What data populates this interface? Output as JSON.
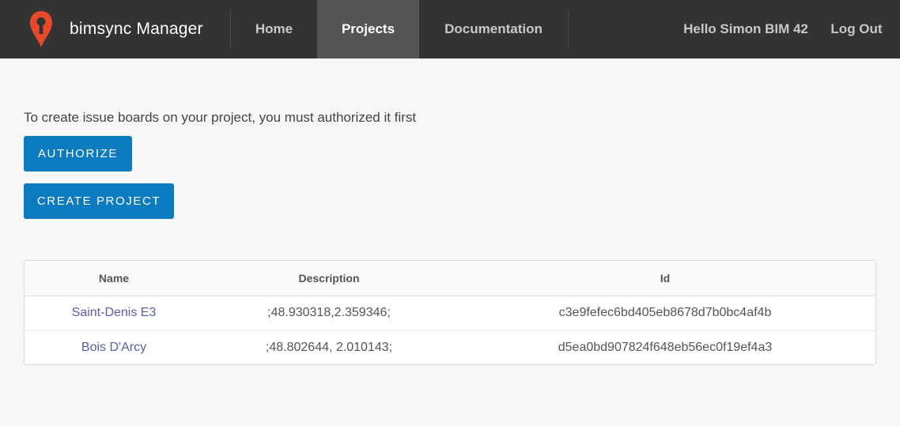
{
  "header": {
    "brand_name": "bimsync Manager",
    "logo_icon": "map-pin-icon",
    "nav": {
      "home": "Home",
      "projects": "Projects",
      "documentation": "Documentation"
    },
    "greeting": "Hello Simon BIM 42",
    "logout": "Log Out",
    "colors": {
      "bar": "#333333",
      "active_tab": "#555555",
      "logo": "#e8492a"
    }
  },
  "main": {
    "intro_text": "To create issue boards on your project, you must authorized it first",
    "authorize_label": "AUTHORIZE",
    "create_project_label": "CREATE PROJECT",
    "button_color": "#0c7bbf"
  },
  "projects_table": {
    "columns": [
      "Name",
      "Description",
      "Id"
    ],
    "rows": [
      {
        "name": "Saint-Denis E3",
        "description": ";48.930318,2.359346;",
        "id": "c3e9fefec6bd405eb8678d7b0bc4af4b"
      },
      {
        "name": "Bois D'Arcy",
        "description": ";48.802644, 2.010143;",
        "id": "d5ea0bd907824f648eb56ec0f19ef4a3"
      }
    ]
  }
}
